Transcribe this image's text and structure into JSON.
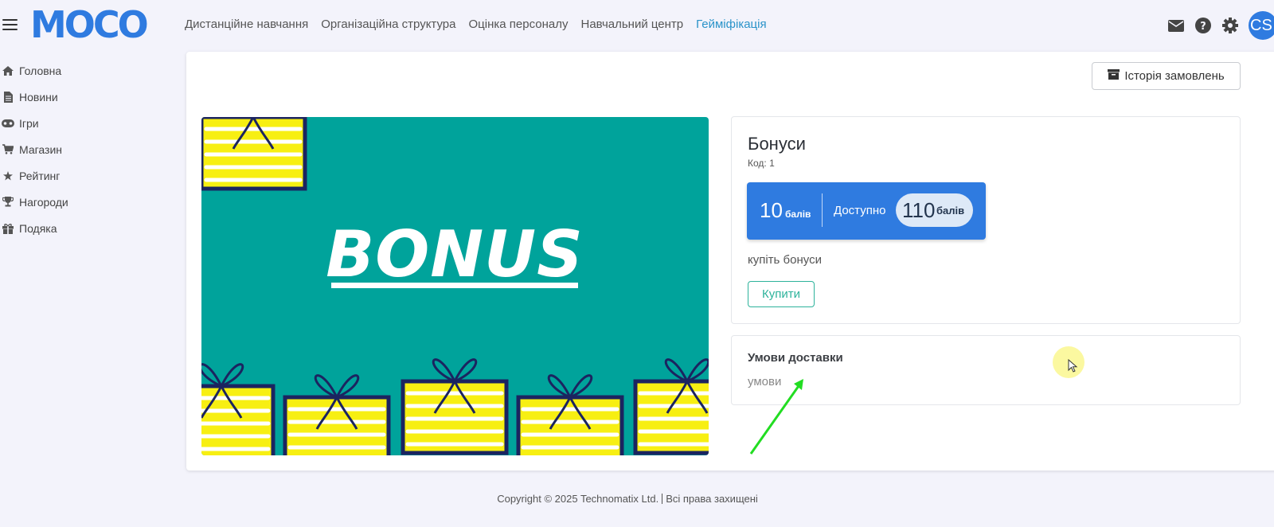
{
  "app": {
    "logo_text": "MOCO"
  },
  "topnav": {
    "items": [
      {
        "label": "Дистанційне навчання",
        "active": false
      },
      {
        "label": "Організаційна структура",
        "active": false
      },
      {
        "label": "Оцінка персоналу",
        "active": false
      },
      {
        "label": "Навчальний центр",
        "active": false
      },
      {
        "label": "Гейміфікація",
        "active": true
      }
    ],
    "icons": [
      "envelope-icon",
      "help-icon",
      "gear-icon"
    ],
    "avatar_initials": "CS"
  },
  "sidebar": {
    "items": [
      {
        "label": "Головна",
        "icon": "home-icon"
      },
      {
        "label": "Новини",
        "icon": "document-icon"
      },
      {
        "label": "Ігри",
        "icon": "gamepad-icon"
      },
      {
        "label": "Магазин",
        "icon": "cart-icon"
      },
      {
        "label": "Рейтинг",
        "icon": "star-icon"
      },
      {
        "label": "Нагороди",
        "icon": "trophy-icon"
      },
      {
        "label": "Подяка",
        "icon": "gift-icon"
      }
    ]
  },
  "main": {
    "history_button": "Історія замовлень",
    "image_text": "BONUS",
    "product": {
      "title": "Бонуси",
      "code": "Код: 1",
      "price_value": "10",
      "price_unit": "балів",
      "available_label": "Доступно",
      "available_value": "110",
      "available_unit": "балів",
      "description": "купіть бонуси",
      "buy_button": "Купити"
    },
    "delivery": {
      "title": "Умови доставки",
      "text": "умови"
    }
  },
  "footer": {
    "copyright": "Copyright © 2025 Technomatix Ltd.",
    "rights": "Всі права захищені"
  },
  "colors": {
    "accent_blue": "#2f7be0",
    "active_nav": "#2a93c9",
    "buy_green": "#2db39b",
    "image_teal": "#00a39b",
    "gift_yellow": "#f7ef12",
    "gift_navy": "#1b2460",
    "arrow_green": "#22dd22"
  }
}
